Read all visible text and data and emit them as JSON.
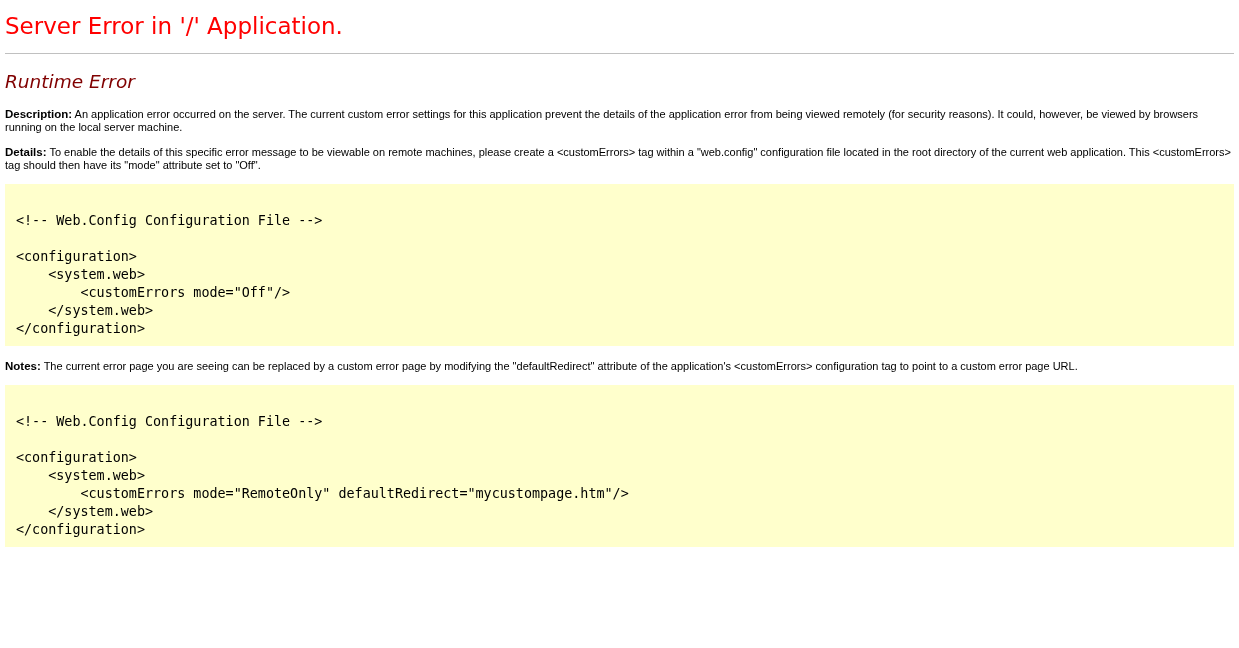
{
  "title": "Server Error in '/' Application.",
  "heading": "Runtime Error",
  "sections": [
    {
      "kind": "paragraph",
      "text": "**Description:** An application error occurred on the server. The current custom error settings for this application prevent the details of the application error from being viewed remotely (for security reasons). It could, however, be viewed by browsers running on the local server machine."
    },
    {
      "kind": "paragraph",
      "text": "**Details:** To enable the details of this specific error message to be viewable on remote machines, please create a <customErrors> tag within a \"web.config\" configuration file located in the root directory of the current web application. This <customErrors> tag should then have its \"mode\" attribute set to \"Off\"."
    },
    {
      "kind": "code",
      "comment": "<!-- Web.Config Configuration File -->",
      "lines": [
        "<configuration>",
        "    <system.web>",
        "        <customErrors mode=\"Off\"/>",
        "    </system.web>",
        "</configuration>"
      ]
    },
    {
      "kind": "paragraph",
      "text": "**Notes:** The current error page you are seeing can be replaced by a custom error page by modifying the \"defaultRedirect\" attribute of the application's <customErrors> configuration tag to point to a custom error page URL."
    },
    {
      "kind": "code",
      "comment": "<!-- Web.Config Configuration File -->",
      "lines": [
        "<configuration>",
        "    <system.web>",
        "        <customErrors mode=\"RemoteOnly\" defaultRedirect=\"mycustompage.htm\"/>",
        "    </system.web>",
        "</configuration>"
      ]
    }
  ]
}
